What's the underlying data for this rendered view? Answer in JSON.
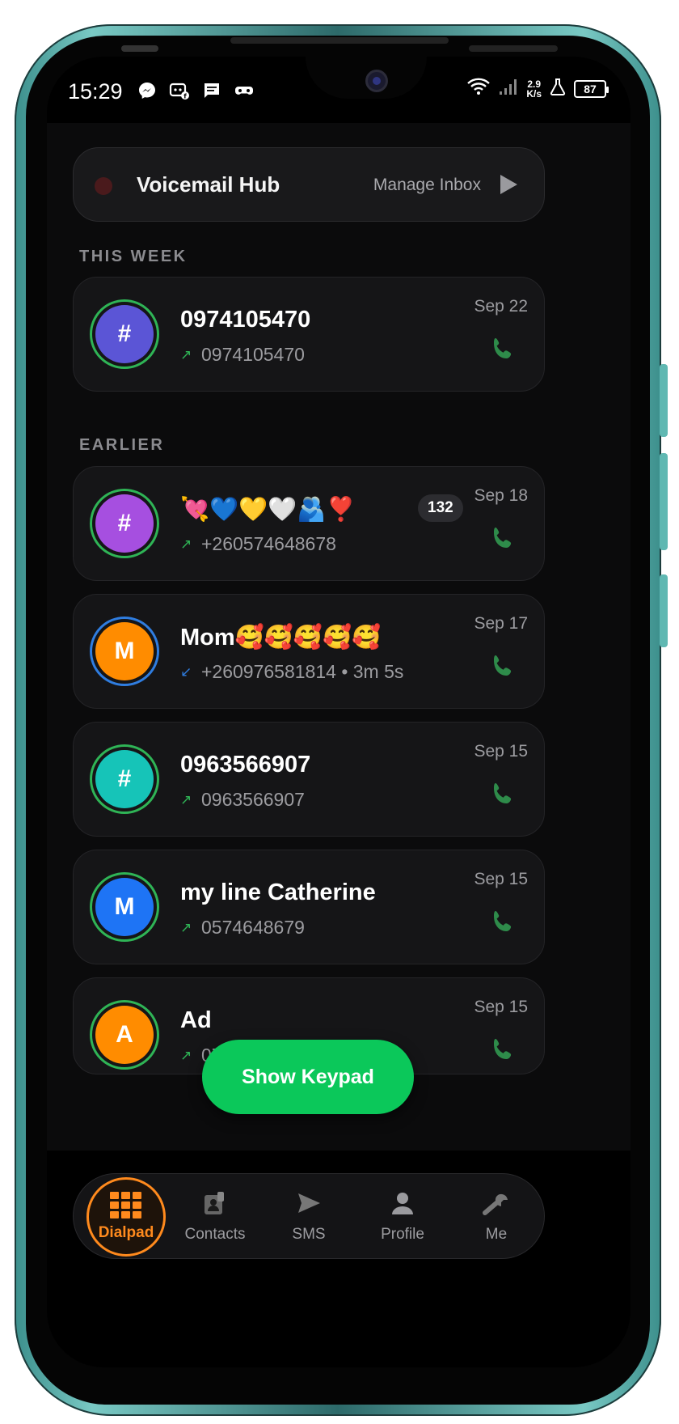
{
  "status_bar": {
    "time": "15:29",
    "net_speed_value": "2.9",
    "net_speed_unit": "K/s",
    "battery": "87"
  },
  "voicemail": {
    "title": "Voicemail Hub",
    "manage_label": "Manage Inbox"
  },
  "sections": {
    "this_week": "THIS WEEK",
    "earlier": "EARLIER"
  },
  "calls": [
    {
      "name": "0974105470",
      "number": "0974105470",
      "direction": "outgoing",
      "arrow": "↗",
      "date": "Sep 22",
      "initial": "#",
      "avatar_color": "#5b55d6",
      "ring_color": "#2fb456",
      "badge": ""
    },
    {
      "name": "💘💙💛🤍🫂❣️",
      "number": "+260574648678",
      "direction": "outgoing",
      "arrow": "↗",
      "date": "Sep 18",
      "initial": "#",
      "avatar_color": "#a64fe0",
      "ring_color": "#2fb456",
      "badge": "132"
    },
    {
      "name": "Mom🥰🥰🥰🥰🥰",
      "number": "+260976581814 • 3m 5s",
      "direction": "incoming",
      "arrow": "↙",
      "date": "Sep 17",
      "initial": "M",
      "avatar_color": "#ff8c00",
      "ring_color": "#2f7de0",
      "badge": ""
    },
    {
      "name": "0963566907",
      "number": "0963566907",
      "direction": "outgoing",
      "arrow": "↗",
      "date": "Sep 15",
      "initial": "#",
      "avatar_color": "#16c4b8",
      "ring_color": "#2fb456",
      "badge": ""
    },
    {
      "name": "my line Catherine",
      "number": "0574648679",
      "direction": "outgoing",
      "arrow": "↗",
      "date": "Sep 15",
      "initial": "M",
      "avatar_color": "#1e74f5",
      "ring_color": "#2fb456",
      "badge": ""
    },
    {
      "name": "Ad",
      "number": "0770933214",
      "direction": "outgoing",
      "arrow": "↗",
      "date": "Sep 15",
      "initial": "A",
      "avatar_color": "#ff8c00",
      "ring_color": "#2fb456",
      "badge": ""
    }
  ],
  "fab": {
    "label": "Show Keypad"
  },
  "nav": {
    "dialpad": "Dialpad",
    "contacts": "Contacts",
    "sms": "SMS",
    "profile": "Profile",
    "me": "Me"
  },
  "colors": {
    "accent_green": "#0bc85a",
    "phone_green": "#2e8b4a",
    "active_orange": "#ff8a1d",
    "background": "#0b0b0c"
  },
  "icons": {
    "status_left": [
      "messenger-icon",
      "messenger-bot-icon",
      "message-icon",
      "gamepad-icon"
    ],
    "status_right": [
      "wifi-icon",
      "signal-icon",
      "flask-icon",
      "battery-icon"
    ],
    "nav": [
      "dialpad-icon",
      "contacts-icon",
      "send-icon",
      "person-icon",
      "wrench-icon"
    ],
    "call_action": "phone-icon",
    "voicemail_action": "play-icon"
  }
}
